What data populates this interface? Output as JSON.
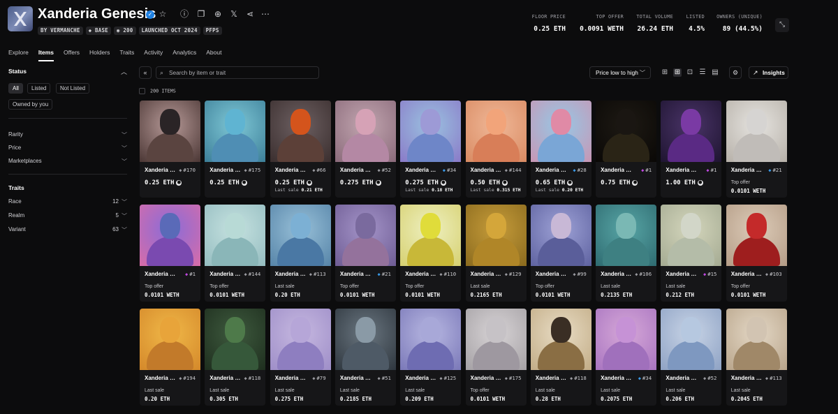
{
  "collection": {
    "title": "Xanderia Genesis",
    "chips": [
      "BY VERMANCHE",
      "BASE",
      "200",
      "LAUNCHED OCT 2024",
      "PFPS"
    ]
  },
  "stats": [
    {
      "label": "FLOOR PRICE",
      "value": "0.25 ETH"
    },
    {
      "label": "TOP OFFER",
      "value": "0.0091 WETH"
    },
    {
      "label": "TOTAL VOLUME",
      "value": "26.24 ETH"
    },
    {
      "label": "LISTED",
      "value": "4.5%"
    },
    {
      "label": "OWNERS (UNIQUE)",
      "value": "89 (44.5%)"
    }
  ],
  "tabs": [
    "Explore",
    "Items",
    "Offers",
    "Holders",
    "Traits",
    "Activity",
    "Analytics",
    "About"
  ],
  "sidebar": {
    "status_title": "Status",
    "status_options": [
      "All",
      "Listed",
      "Not Listed",
      "Owned by you"
    ],
    "filters": [
      "Rarity",
      "Price",
      "Marketplaces"
    ],
    "traits_title": "Traits",
    "traits": [
      {
        "label": "Race",
        "count": "12"
      },
      {
        "label": "Realm",
        "count": "5"
      },
      {
        "label": "Variant",
        "count": "63"
      }
    ]
  },
  "toolbar": {
    "search_placeholder": "Search by item or trait",
    "sort_label": "Price low to high",
    "insights_label": "Insights"
  },
  "items_count": "200 ITEMS",
  "colors": {
    "accent": "#2081e2",
    "rarity_purple": "#c048e0",
    "rarity_blue": "#3a9ae8"
  },
  "cards": [
    {
      "name": "Xanderia Genesis",
      "token": "#170",
      "rarity": "",
      "price": "0.25 ETH",
      "sub_label": "",
      "sub_value": "",
      "bg": [
        "#b79a98",
        "#4a3634"
      ],
      "skin": "#2a2426",
      "suit": "#5a4440"
    },
    {
      "name": "Xanderia Genesis",
      "token": "#175",
      "rarity": "",
      "price": "0.25 ETH",
      "sub_label": "",
      "sub_value": "",
      "bg": [
        "#7fc8d6",
        "#3c7e98"
      ],
      "skin": "#5fb4d2",
      "suit": "#4f8eb4"
    },
    {
      "name": "Xanderia Genesis",
      "token": "#66",
      "rarity": "",
      "price": "0.25 ETH",
      "sub_label": "Last sale",
      "sub_value": "0.21 ETH",
      "bg": [
        "#6d6062",
        "#3a2e2e"
      ],
      "skin": "#d4541c",
      "suit": "#5c4038"
    },
    {
      "name": "Xanderia Genesis",
      "token": "#52",
      "rarity": "",
      "price": "0.275 ETH",
      "sub_label": "",
      "sub_value": "",
      "bg": [
        "#c2a6b0",
        "#8a6a7a"
      ],
      "skin": "#d6a2b6",
      "suit": "#b488a4"
    },
    {
      "name": "Xanderia Genesis",
      "token": "#34",
      "rarity": "blue",
      "price": "0.275 ETH",
      "sub_label": "Last sale",
      "sub_value": "0.18 ETH",
      "bg": [
        "#9ac2e0",
        "#8a7ac8"
      ],
      "skin": "#9d9ad6",
      "suit": "#6e86c8"
    },
    {
      "name": "Xanderia Genesis",
      "token": "#144",
      "rarity": "",
      "price": "0.50 ETH",
      "sub_label": "Last sale",
      "sub_value": "0.315 ETH",
      "bg": [
        "#f0b898",
        "#d88a62"
      ],
      "skin": "#f2a47a",
      "suit": "#d87e58"
    },
    {
      "name": "Xanderia Genesis",
      "token": "#28",
      "rarity": "blue",
      "price": "0.65 ETH",
      "sub_label": "Last sale",
      "sub_value": "0.20 ETH",
      "bg": [
        "#96c8e6",
        "#c896b4"
      ],
      "skin": "#e08aa6",
      "suit": "#7aa6d6"
    },
    {
      "name": "Xanderia Genesis",
      "token": "#1",
      "rarity": "purple",
      "price": "0.75 ETH",
      "sub_label": "",
      "sub_value": "",
      "bg": [
        "#1e1a14",
        "#0a0806"
      ],
      "skin": "#1a1612",
      "suit": "#2a2416"
    },
    {
      "name": "Xanderia Genesis",
      "token": "#1",
      "rarity": "purple",
      "price": "1.00 ETH",
      "sub_label": "",
      "sub_value": "",
      "bg": [
        "#4a3468",
        "#1e1430"
      ],
      "skin": "#7a3aa4",
      "suit": "#5a2a84"
    },
    {
      "name": "Xanderia Genesis",
      "token": "#21",
      "rarity": "blue",
      "price": "",
      "sub_label": "Top offer",
      "sub_value": "0.0101 WETH",
      "bg": [
        "#e6e4e0",
        "#b6b0a8"
      ],
      "skin": "#d6d4d2",
      "suit": "#c0bcb8"
    },
    {
      "name": "Xanderia Genesis",
      "token": "#1",
      "rarity": "purple",
      "price": "",
      "sub_label": "Top offer",
      "sub_value": "0.0101 WETH",
      "bg": [
        "#8a6cd8",
        "#d86ca8"
      ],
      "skin": "#5a6ab8",
      "suit": "#7a4ab0"
    },
    {
      "name": "Xanderia Genesis",
      "token": "#144",
      "rarity": "",
      "price": "",
      "sub_label": "Top offer",
      "sub_value": "0.0101 WETH",
      "bg": [
        "#c6e2e0",
        "#94bcc0"
      ],
      "skin": "#b8dad6",
      "suit": "#8ab6b8"
    },
    {
      "name": "Xanderia Genesis",
      "token": "#113",
      "rarity": "",
      "price": "",
      "sub_label": "Last sale",
      "sub_value": "0.20 ETH",
      "bg": [
        "#98c0d8",
        "#5684a8"
      ],
      "skin": "#7cb0d4",
      "suit": "#4a78a4"
    },
    {
      "name": "Xanderia Genesis",
      "token": "#21",
      "rarity": "blue",
      "price": "",
      "sub_label": "Top offer",
      "sub_value": "0.0101 WETH",
      "bg": [
        "#a494c8",
        "#6e5c94"
      ],
      "skin": "#7a6a9e",
      "suit": "#94729c"
    },
    {
      "name": "Xanderia Genesis",
      "token": "#110",
      "rarity": "",
      "price": "",
      "sub_label": "Top offer",
      "sub_value": "0.0101 WETH",
      "bg": [
        "#eef0c0",
        "#d6d070"
      ],
      "skin": "#e0dc3a",
      "suit": "#c8b838"
    },
    {
      "name": "Xanderia Genesis",
      "token": "#129",
      "rarity": "",
      "price": "",
      "sub_label": "Last sale",
      "sub_value": "0.2165 ETH",
      "bg": [
        "#c69c3a",
        "#8a6a1e"
      ],
      "skin": "#d4a63a",
      "suit": "#b08628"
    },
    {
      "name": "Xanderia Genesis",
      "token": "#99",
      "rarity": "",
      "price": "",
      "sub_label": "Top offer",
      "sub_value": "0.0101 WETH",
      "bg": [
        "#9ea2d6",
        "#5e62a0"
      ],
      "skin": "#c8b8d6",
      "suit": "#5a5e9a"
    },
    {
      "name": "Xanderia Genesis",
      "token": "#106",
      "rarity": "",
      "price": "",
      "sub_label": "Last sale",
      "sub_value": "0.2135 ETH",
      "bg": [
        "#58a6a6",
        "#2e6a70"
      ],
      "skin": "#7ab8b4",
      "suit": "#3e8082"
    },
    {
      "name": "Xanderia Genesis",
      "token": "#15",
      "rarity": "purple",
      "price": "",
      "sub_label": "Last sale",
      "sub_value": "0.212 ETH",
      "bg": [
        "#d4d6bc",
        "#a4aa92"
      ],
      "skin": "#d2d6c8",
      "suit": "#b4bca8"
    },
    {
      "name": "Xanderia Genesis",
      "token": "#103",
      "rarity": "",
      "price": "",
      "sub_label": "Top offer",
      "sub_value": "0.0101 WETH",
      "bg": [
        "#dccbb8",
        "#b49c86"
      ],
      "skin": "#c42a2a",
      "suit": "#9e1e1e"
    },
    {
      "name": "Xanderia Genesis",
      "token": "#194",
      "rarity": "",
      "price": "",
      "sub_label": "Last sale",
      "sub_value": "0.20 ETH",
      "bg": [
        "#f0b848",
        "#d4882a"
      ],
      "skin": "#e8a43a",
      "suit": "#c27a2a"
    },
    {
      "name": "Xanderia Genesis",
      "token": "#118",
      "rarity": "",
      "price": "",
      "sub_label": "Last sale",
      "sub_value": "0.305 ETH",
      "bg": [
        "#3e5a3e",
        "#1e2e1e"
      ],
      "skin": "#4e7a4a",
      "suit": "#36583a"
    },
    {
      "name": "Xanderia Genesis",
      "token": "#79",
      "rarity": "",
      "price": "",
      "sub_label": "Last sale",
      "sub_value": "0.275 ETH",
      "bg": [
        "#c6b8e0",
        "#9e8ec8"
      ],
      "skin": "#b6a6d8",
      "suit": "#8e7ec0"
    },
    {
      "name": "Xanderia Genesis",
      "token": "#51",
      "rarity": "",
      "price": "",
      "sub_label": "Last sale",
      "sub_value": "0.2185 ETH",
      "bg": [
        "#6a7680",
        "#2e363e"
      ],
      "skin": "#8a9aa6",
      "suit": "#4e5a66"
    },
    {
      "name": "Xanderia Genesis",
      "token": "#125",
      "rarity": "",
      "price": "",
      "sub_label": "Last sale",
      "sub_value": "0.209 ETH",
      "bg": [
        "#b8b8e2",
        "#7a78b8"
      ],
      "skin": "#a8a8d8",
      "suit": "#6e6cb2"
    },
    {
      "name": "Xanderia Genesis",
      "token": "#175",
      "rarity": "",
      "price": "",
      "sub_label": "Top offer",
      "sub_value": "0.0101 WETH",
      "bg": [
        "#d8d4d6",
        "#a4a0a4"
      ],
      "skin": "#c6c2c6",
      "suit": "#9e98a0"
    },
    {
      "name": "Xanderia Genesis",
      "token": "#118",
      "rarity": "",
      "price": "",
      "sub_label": "Last sale",
      "sub_value": "0.28 ETH",
      "bg": [
        "#e8dcc4",
        "#c2ac86"
      ],
      "skin": "#3a2e24",
      "suit": "#8a6e44"
    },
    {
      "name": "Xanderia Genesis",
      "token": "#34",
      "rarity": "blue",
      "price": "",
      "sub_label": "Last sale",
      "sub_value": "0.2075 ETH",
      "bg": [
        "#d6a8d8",
        "#a874c0"
      ],
      "skin": "#c692d6",
      "suit": "#a070bc"
    },
    {
      "name": "Xanderia Genesis",
      "token": "#52",
      "rarity": "",
      "price": "",
      "sub_label": "Last sale",
      "sub_value": "0.206 ETH",
      "bg": [
        "#c8d4e6",
        "#8ea2c4"
      ],
      "skin": "#b6c8e0",
      "suit": "#7e98c0"
    },
    {
      "name": "Xanderia Genesis",
      "token": "#113",
      "rarity": "",
      "price": "",
      "sub_label": "Last sale",
      "sub_value": "0.2045 ETH",
      "bg": [
        "#e4d8c6",
        "#b8a48a"
      ],
      "skin": "#d2c4b2",
      "suit": "#a08868"
    }
  ]
}
